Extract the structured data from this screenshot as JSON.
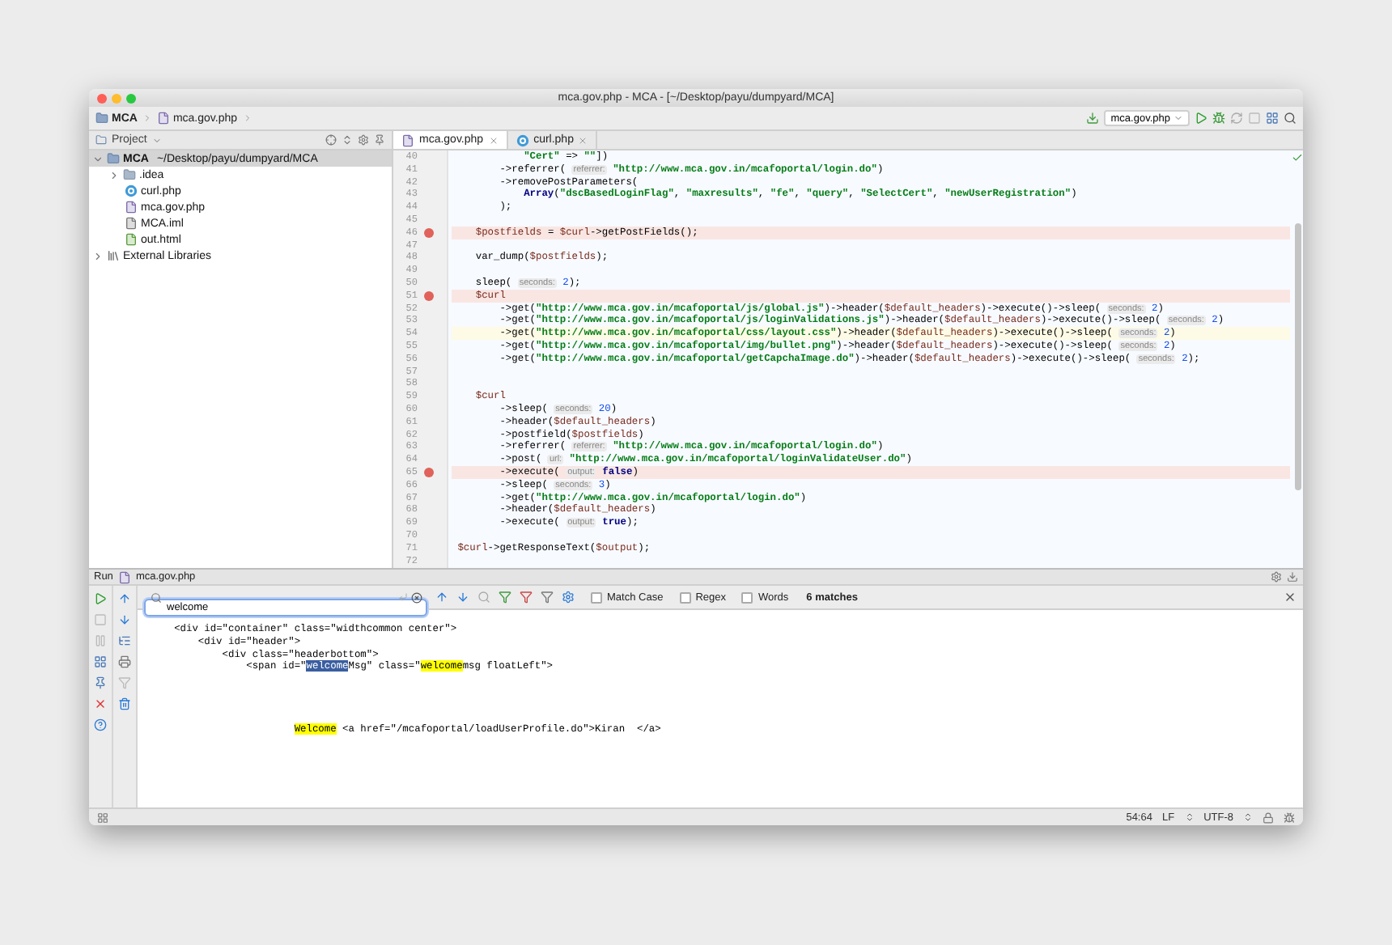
{
  "window": {
    "title": "mca.gov.php - MCA - [~/Desktop/payu/dumpyard/MCA]"
  },
  "breadcrumbs": [
    {
      "label": "MCA",
      "kind": "module"
    },
    {
      "label": "mca.gov.php",
      "kind": "php"
    }
  ],
  "toolbar": {
    "run_config": "mca.gov.php"
  },
  "project_panel": {
    "title": "Project",
    "tree": [
      {
        "label": "MCA",
        "path": "~/Desktop/payu/dumpyard/MCA",
        "kind": "module",
        "expanded": true,
        "selected": true,
        "children": [
          {
            "label": ".idea",
            "kind": "folder",
            "expanded": false,
            "selected": false
          },
          {
            "label": "curl.php",
            "kind": "class",
            "selected": false
          },
          {
            "label": "mca.gov.php",
            "kind": "php",
            "selected": false
          },
          {
            "label": "MCA.iml",
            "kind": "iml",
            "selected": false
          },
          {
            "label": "out.html",
            "kind": "html",
            "selected": false
          }
        ]
      },
      {
        "label": "External Libraries",
        "kind": "library",
        "expanded": false,
        "selected": false
      }
    ]
  },
  "editor": {
    "tabs": [
      {
        "label": "mca.gov.php",
        "kind": "php",
        "selected": true
      },
      {
        "label": "curl.php",
        "kind": "class",
        "selected": false
      }
    ],
    "lines": [
      {
        "n": "40",
        "breakpoint": false,
        "current": false,
        "segs": [
          {
            "kind": "string",
            "text": "            \"Cert\""
          },
          {
            "kind": "plain",
            "text": " => "
          },
          {
            "kind": "string",
            "text": "\"\""
          },
          {
            "kind": "plain",
            "text": "])"
          }
        ]
      },
      {
        "n": "41",
        "breakpoint": false,
        "current": false,
        "segs": [
          {
            "kind": "plain",
            "text": "        ->referrer( "
          },
          {
            "kind": "hint",
            "text": "referrer:"
          },
          {
            "kind": "string",
            "text": " \"http://www.mca.gov.in/mcafoportal/login.do\""
          },
          {
            "kind": "plain",
            "text": ")"
          }
        ]
      },
      {
        "n": "42",
        "breakpoint": false,
        "current": false,
        "segs": [
          {
            "kind": "plain",
            "text": "        ->removePostParameters("
          }
        ]
      },
      {
        "n": "43",
        "breakpoint": false,
        "current": false,
        "segs": [
          {
            "kind": "keyword",
            "text": "            Array"
          },
          {
            "kind": "plain",
            "text": "("
          },
          {
            "kind": "string",
            "text": "\"dscBasedLoginFlag\""
          },
          {
            "kind": "plain",
            "text": ", "
          },
          {
            "kind": "string",
            "text": "\"maxresults\""
          },
          {
            "kind": "plain",
            "text": ", "
          },
          {
            "kind": "string",
            "text": "\"fe\""
          },
          {
            "kind": "plain",
            "text": ", "
          },
          {
            "kind": "string",
            "text": "\"query\""
          },
          {
            "kind": "plain",
            "text": ", "
          },
          {
            "kind": "string",
            "text": "\"SelectCert\""
          },
          {
            "kind": "plain",
            "text": ", "
          },
          {
            "kind": "string",
            "text": "\"newUserRegistration\""
          },
          {
            "kind": "plain",
            "text": ")"
          }
        ]
      },
      {
        "n": "44",
        "breakpoint": false,
        "current": false,
        "segs": [
          {
            "kind": "plain",
            "text": "        );"
          }
        ]
      },
      {
        "n": "45",
        "breakpoint": false,
        "current": false
      },
      {
        "n": "46",
        "breakpoint": true,
        "current": false,
        "segs": [
          {
            "kind": "variable",
            "text": "    $postfields"
          },
          {
            "kind": "plain",
            "text": " = "
          },
          {
            "kind": "variable",
            "text": "$curl"
          },
          {
            "kind": "plain",
            "text": "->getPostFields();"
          }
        ]
      },
      {
        "n": "47",
        "breakpoint": false,
        "current": false
      },
      {
        "n": "48",
        "breakpoint": false,
        "current": false,
        "segs": [
          {
            "kind": "plain",
            "text": "    var_dump("
          },
          {
            "kind": "variable",
            "text": "$postfields"
          },
          {
            "kind": "plain",
            "text": ");"
          }
        ]
      },
      {
        "n": "49",
        "breakpoint": false,
        "current": false
      },
      {
        "n": "50",
        "breakpoint": false,
        "current": false,
        "segs": [
          {
            "kind": "plain",
            "text": "    sleep( "
          },
          {
            "kind": "hint",
            "text": "seconds:"
          },
          {
            "kind": "number",
            "text": " 2"
          },
          {
            "kind": "plain",
            "text": ");"
          }
        ]
      },
      {
        "n": "51",
        "breakpoint": true,
        "current": false,
        "segs": [
          {
            "kind": "variable",
            "text": "    $curl"
          }
        ]
      },
      {
        "n": "52",
        "breakpoint": false,
        "current": false,
        "segs": [
          {
            "kind": "plain",
            "text": "        ->get("
          },
          {
            "kind": "string",
            "text": "\"http://www.mca.gov.in/mcafoportal/js/global.js\""
          },
          {
            "kind": "plain",
            "text": ")->header("
          },
          {
            "kind": "variable",
            "text": "$default_headers"
          },
          {
            "kind": "plain",
            "text": ")->execute()->sleep( "
          },
          {
            "kind": "hint",
            "text": "seconds:"
          },
          {
            "kind": "number",
            "text": " 2"
          },
          {
            "kind": "plain",
            "text": ")"
          }
        ]
      },
      {
        "n": "53",
        "breakpoint": false,
        "current": false,
        "segs": [
          {
            "kind": "plain",
            "text": "        ->get("
          },
          {
            "kind": "string",
            "text": "\"http://www.mca.gov.in/mcafoportal/js/loginValidations.js\""
          },
          {
            "kind": "plain",
            "text": ")->header("
          },
          {
            "kind": "variable",
            "text": "$default_headers"
          },
          {
            "kind": "plain",
            "text": ")->execute()->sleep( "
          },
          {
            "kind": "hint",
            "text": "seconds:"
          },
          {
            "kind": "number",
            "text": " 2"
          },
          {
            "kind": "plain",
            "text": ")"
          }
        ]
      },
      {
        "n": "54",
        "breakpoint": false,
        "current": true,
        "segs": [
          {
            "kind": "plain",
            "text": "        ->get("
          },
          {
            "kind": "string",
            "text": "\"http://www.mca.gov.in/mcafoportal/css/layout.css\""
          },
          {
            "kind": "plain",
            "text": ")->header("
          },
          {
            "kind": "variable",
            "text": "$default_headers"
          },
          {
            "kind": "plain",
            "text": ")->execute()->sleep( "
          },
          {
            "kind": "hint",
            "text": "seconds:"
          },
          {
            "kind": "number",
            "text": " 2"
          },
          {
            "kind": "plain",
            "text": ")"
          }
        ]
      },
      {
        "n": "55",
        "breakpoint": false,
        "current": false,
        "segs": [
          {
            "kind": "plain",
            "text": "        ->get("
          },
          {
            "kind": "string",
            "text": "\"http://www.mca.gov.in/mcafoportal/img/bullet.png\""
          },
          {
            "kind": "plain",
            "text": ")->header("
          },
          {
            "kind": "variable",
            "text": "$default_headers"
          },
          {
            "kind": "plain",
            "text": ")->execute()->sleep( "
          },
          {
            "kind": "hint",
            "text": "seconds:"
          },
          {
            "kind": "number",
            "text": " 2"
          },
          {
            "kind": "plain",
            "text": ")"
          }
        ]
      },
      {
        "n": "56",
        "breakpoint": false,
        "current": false,
        "segs": [
          {
            "kind": "plain",
            "text": "        ->get("
          },
          {
            "kind": "string",
            "text": "\"http://www.mca.gov.in/mcafoportal/getCapchaImage.do\""
          },
          {
            "kind": "plain",
            "text": ")->header("
          },
          {
            "kind": "variable",
            "text": "$default_headers"
          },
          {
            "kind": "plain",
            "text": ")->execute()->sleep( "
          },
          {
            "kind": "hint",
            "text": "seconds:"
          },
          {
            "kind": "number",
            "text": " 2"
          },
          {
            "kind": "plain",
            "text": ");"
          }
        ]
      },
      {
        "n": "57",
        "breakpoint": false,
        "current": false
      },
      {
        "n": "58",
        "breakpoint": false,
        "current": false
      },
      {
        "n": "59",
        "breakpoint": false,
        "current": false,
        "segs": [
          {
            "kind": "variable",
            "text": "    $curl"
          }
        ]
      },
      {
        "n": "60",
        "breakpoint": false,
        "current": false,
        "segs": [
          {
            "kind": "plain",
            "text": "        ->sleep( "
          },
          {
            "kind": "hint",
            "text": "seconds:"
          },
          {
            "kind": "number",
            "text": " 20"
          },
          {
            "kind": "plain",
            "text": ")"
          }
        ]
      },
      {
        "n": "61",
        "breakpoint": false,
        "current": false,
        "segs": [
          {
            "kind": "plain",
            "text": "        ->header("
          },
          {
            "kind": "variable",
            "text": "$default_headers"
          },
          {
            "kind": "plain",
            "text": ")"
          }
        ]
      },
      {
        "n": "62",
        "breakpoint": false,
        "current": false,
        "segs": [
          {
            "kind": "plain",
            "text": "        ->postfield("
          },
          {
            "kind": "variable",
            "text": "$postfields"
          },
          {
            "kind": "plain",
            "text": ")"
          }
        ]
      },
      {
        "n": "63",
        "breakpoint": false,
        "current": false,
        "segs": [
          {
            "kind": "plain",
            "text": "        ->referrer( "
          },
          {
            "kind": "hint",
            "text": "referrer:"
          },
          {
            "kind": "string",
            "text": " \"http://www.mca.gov.in/mcafoportal/login.do\""
          },
          {
            "kind": "plain",
            "text": ")"
          }
        ]
      },
      {
        "n": "64",
        "breakpoint": false,
        "current": false,
        "segs": [
          {
            "kind": "plain",
            "text": "        ->post( "
          },
          {
            "kind": "hint",
            "text": "url:"
          },
          {
            "kind": "string",
            "text": " \"http://www.mca.gov.in/mcafoportal/loginValidateUser.do\""
          },
          {
            "kind": "plain",
            "text": ")"
          }
        ]
      },
      {
        "n": "65",
        "breakpoint": true,
        "current": false,
        "segs": [
          {
            "kind": "plain",
            "text": "        ->execute( "
          },
          {
            "kind": "hint",
            "text": "output:"
          },
          {
            "kind": "keyword",
            "text": " false"
          },
          {
            "kind": "plain",
            "text": ")"
          }
        ]
      },
      {
        "n": "66",
        "breakpoint": false,
        "current": false,
        "segs": [
          {
            "kind": "plain",
            "text": "        ->sleep( "
          },
          {
            "kind": "hint",
            "text": "seconds:"
          },
          {
            "kind": "number",
            "text": " 3"
          },
          {
            "kind": "plain",
            "text": ")"
          }
        ]
      },
      {
        "n": "67",
        "breakpoint": false,
        "current": false,
        "segs": [
          {
            "kind": "plain",
            "text": "        ->get("
          },
          {
            "kind": "string",
            "text": "\"http://www.mca.gov.in/mcafoportal/login.do\""
          },
          {
            "kind": "plain",
            "text": ")"
          }
        ]
      },
      {
        "n": "68",
        "breakpoint": false,
        "current": false,
        "segs": [
          {
            "kind": "plain",
            "text": "        ->header("
          },
          {
            "kind": "variable",
            "text": "$default_headers"
          },
          {
            "kind": "plain",
            "text": ")"
          }
        ]
      },
      {
        "n": "69",
        "breakpoint": false,
        "current": false,
        "segs": [
          {
            "kind": "plain",
            "text": "        ->execute( "
          },
          {
            "kind": "hint",
            "text": "output:"
          },
          {
            "kind": "keyword",
            "text": " true"
          },
          {
            "kind": "plain",
            "text": ");"
          }
        ]
      },
      {
        "n": "70",
        "breakpoint": false,
        "current": false
      },
      {
        "n": "71",
        "breakpoint": false,
        "current": false,
        "segs": [
          {
            "kind": "variable",
            "text": " $curl"
          },
          {
            "kind": "plain",
            "text": "->getResponseText("
          },
          {
            "kind": "variable",
            "text": "$output"
          },
          {
            "kind": "plain",
            "text": ");"
          }
        ]
      },
      {
        "n": "72",
        "breakpoint": false,
        "current": false
      }
    ]
  },
  "run_panel": {
    "label": "Run",
    "config": "mca.gov.php",
    "find": {
      "value": "welcome",
      "options": [
        {
          "label": "Match Case",
          "checked": false
        },
        {
          "label": "Regex",
          "checked": false
        },
        {
          "label": "Words",
          "checked": false
        }
      ],
      "count": "6 matches"
    },
    "output": [
      {
        "segs": [
          {
            "kind": "plain",
            "text": "     <div id=\"container\" class=\"widthcommon center\">"
          }
        ]
      },
      {
        "segs": [
          {
            "kind": "plain",
            "text": "         <div id=\"header\">"
          }
        ]
      },
      {
        "segs": [
          {
            "kind": "plain",
            "text": "             <div class=\"headerbottom\">"
          }
        ]
      },
      {
        "segs": [
          {
            "kind": "plain",
            "text": "                 <span id=\""
          },
          {
            "kind": "current",
            "text": "welcome"
          },
          {
            "kind": "plain",
            "text": "Msg\" class=\""
          },
          {
            "kind": "match",
            "text": "welcome"
          },
          {
            "kind": "plain",
            "text": "msg floatLeft\">"
          }
        ]
      },
      {
        "segs": [
          {
            "kind": "match",
            "text": "                         Welcome"
          },
          {
            "kind": "plain",
            "text": " <a href=\"/mcafoportal/loadUserProfile.do\">Kiran  </a>"
          }
        ]
      }
    ]
  },
  "status_bar": {
    "position": "54:64",
    "line_separator": "LF",
    "encoding": "UTF-8"
  }
}
